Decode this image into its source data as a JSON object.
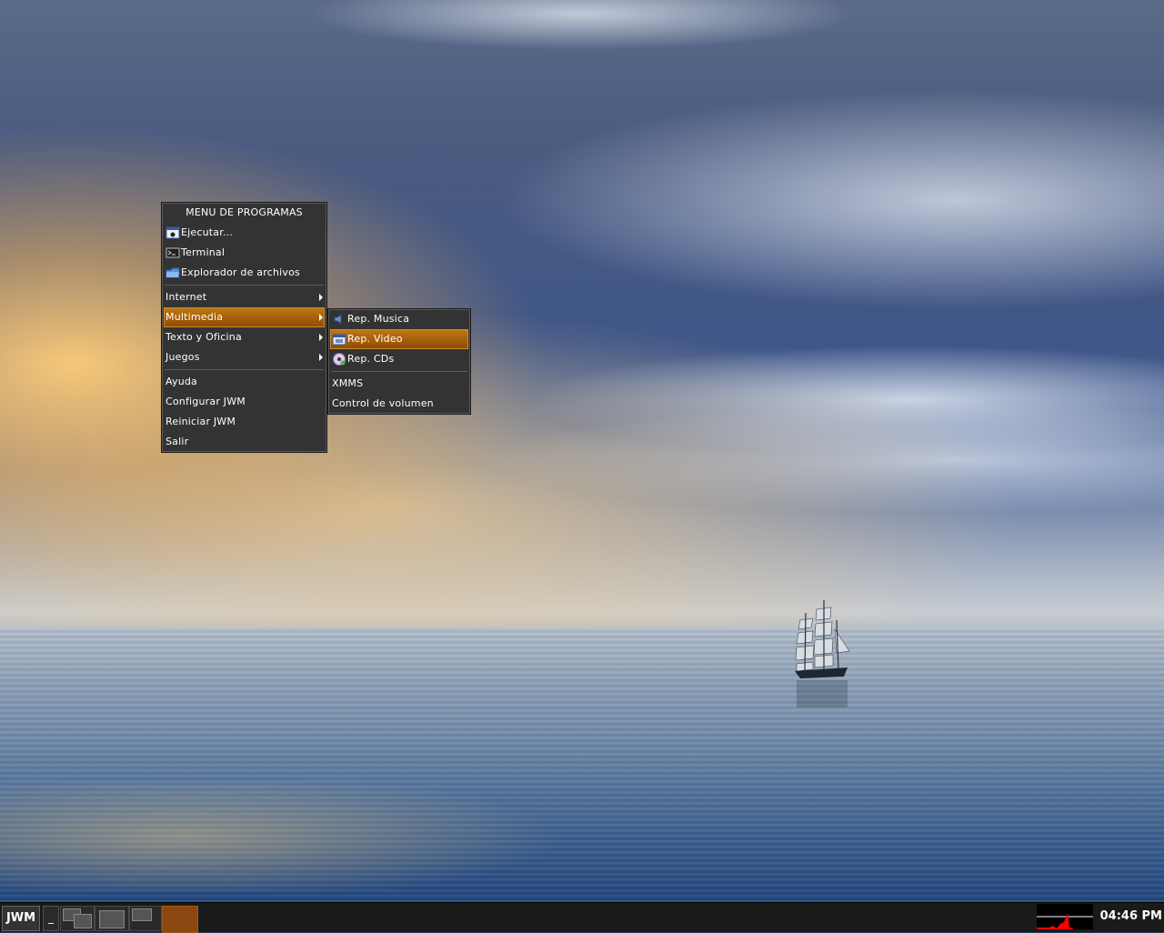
{
  "desktop": {
    "wallpaper": "ocean-sunset-ship"
  },
  "main_menu": {
    "title": "MENU DE PROGRAMAS",
    "items": [
      {
        "label": "Ejecutar...",
        "icon": "run-icon"
      },
      {
        "label": "Terminal",
        "icon": "terminal-icon"
      },
      {
        "label": "Explorador de archivos",
        "icon": "folder-icon"
      },
      {
        "label": "Internet",
        "submenu": true
      },
      {
        "label": "Multimedia",
        "submenu": true,
        "selected": true
      },
      {
        "label": "Texto y Oficina",
        "submenu": true
      },
      {
        "label": "Juegos",
        "submenu": true
      },
      {
        "label": "Ayuda"
      },
      {
        "label": "Configurar JWM"
      },
      {
        "label": "Reiniciar JWM"
      },
      {
        "label": "Salir"
      }
    ]
  },
  "multimedia_menu": {
    "items": [
      {
        "label": "Rep. Musica",
        "icon": "speaker-icon"
      },
      {
        "label": "Rep. Video",
        "icon": "video-icon",
        "selected": true
      },
      {
        "label": "Rep. CDs",
        "icon": "cd-icon"
      },
      {
        "label": "XMMS"
      },
      {
        "label": "Control de volumen"
      }
    ]
  },
  "taskbar": {
    "start_label": "JWM",
    "show_desktop_label": "_",
    "clock": "04:46 PM"
  },
  "colors": {
    "menu_bg": "#333333",
    "highlight": "#a8600a",
    "taskbar_bg": "#1a1a1a",
    "load_graph": "#ff0000"
  }
}
